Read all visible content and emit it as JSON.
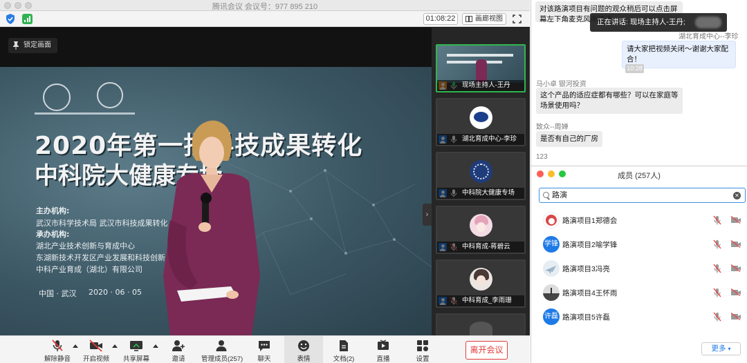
{
  "window": {
    "title": "腾讯会议 会议号：977 895 210"
  },
  "topbar": {
    "timer": "01:08:22",
    "view_label": "画廊视图"
  },
  "main_video": {
    "lock_label": "锁定画面",
    "slide": {
      "title_line1": "2020年第一批科技成果转化",
      "title_line2": "中科院大健康专场",
      "organizer_label": "主办机构:",
      "organizers": "武汉市科学技术局   武汉市科技成果转化",
      "undertaker_label": "承办机构:",
      "undertaker1": "湖北产业技术创新与育成中心",
      "undertaker2": "东湖新技术开发区产业发展和科技创新",
      "undertaker3": "中科产业育成（湖北）有限公司",
      "location": "中国 · 武汉",
      "date": "2020 · 06 · 05"
    }
  },
  "participants": [
    {
      "name": "现场主持人-王丹",
      "avatar": "slide"
    },
    {
      "name": "湖北育成中心-李珍",
      "avatar": "logo"
    },
    {
      "name": "中科院大健康专场",
      "avatar": "seal"
    },
    {
      "name": "中科育成-蒋碧云",
      "avatar": "girl"
    },
    {
      "name": "中科育成_李雨珊",
      "avatar": "girl2"
    }
  ],
  "toolbar": {
    "mute": "解除静音",
    "video": "开启视频",
    "share": "共享屏幕",
    "invite": "邀请",
    "manage": "管理成员(257)",
    "chat": "聊天",
    "emoji": "表情",
    "docs": "文档(2)",
    "live": "直播",
    "settings": "设置",
    "leave": "离开会议"
  },
  "chat": {
    "msg1": "对该路演项目有问题的观众稍后可以点击屏幕左下角麦克风申请连",
    "sender_partial": "湖北育成中心--李珍",
    "msg_me": "请大家把视频关闭～谢谢大家配合！",
    "timestamp": "10:28",
    "sender2": "马小卓 银河投资",
    "msg2": "这个产品的适应症都有哪些？可以在家庭等场景使用吗？",
    "sender3": "致众--周婵",
    "msg3": "是否有自己的厂房",
    "sender4": "123",
    "speaking": "正在讲话: 现场主持人-王丹;"
  },
  "members": {
    "title": "成员 (257人)",
    "search_value": "路演",
    "list": [
      {
        "name": "路演项目1郑德会",
        "avatar": "",
        "color": "#d94848"
      },
      {
        "name": "路演项目2喻学锋",
        "avatar": "学锋",
        "color": "#1e7ae6"
      },
      {
        "name": "路演项目3冯亮",
        "avatar": "",
        "color": "#9eb6cc"
      },
      {
        "name": "路演项目4王怀雨",
        "avatar": "",
        "color": "#6a6a6a"
      },
      {
        "name": "路演项目5许磊",
        "avatar": "许磊",
        "color": "#1e7ae6"
      }
    ],
    "more_label": "更多"
  }
}
